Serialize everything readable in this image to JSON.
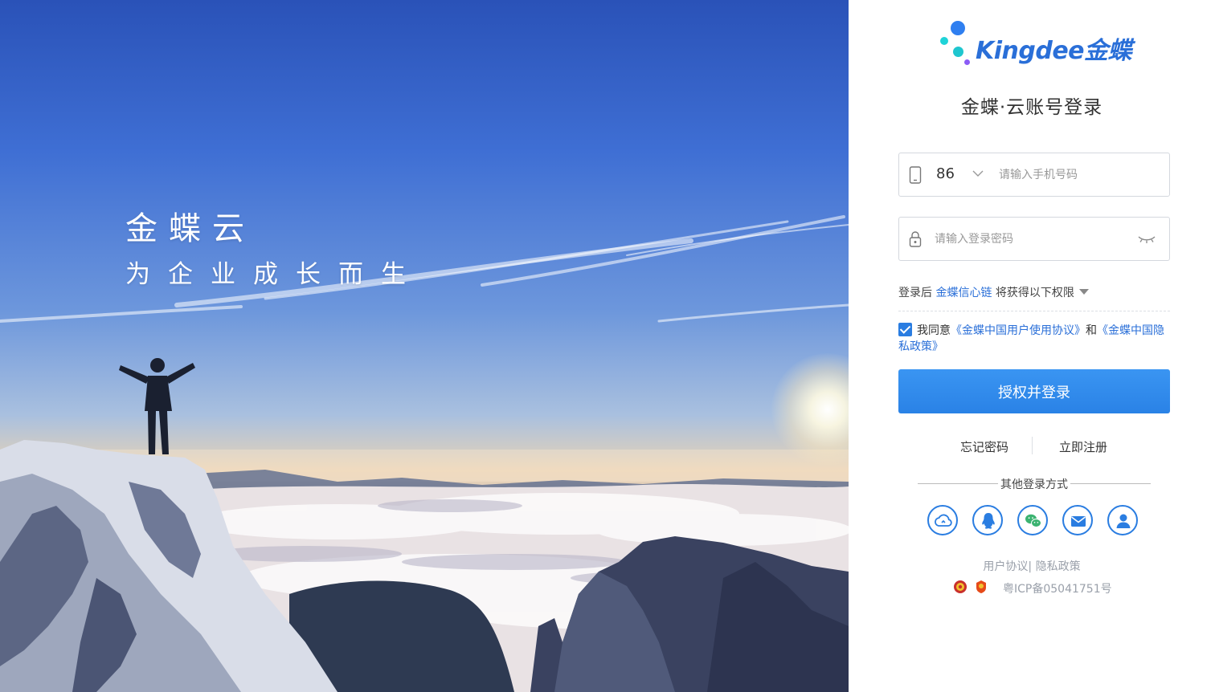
{
  "hero": {
    "title": "金蝶云",
    "subtitle": "为企业成长而生"
  },
  "brand": {
    "logo_text": "Kingdee金蝶",
    "accent": "#2a6fd8",
    "dot_colors": [
      "#2f7ff0",
      "#1fd3d8",
      "#1fc6cf",
      "#8b5cf6"
    ]
  },
  "login": {
    "title": "金蝶·云账号登录",
    "country_code": "86",
    "phone_placeholder": "请输入手机号码",
    "password_placeholder": "请输入登录密码",
    "permission_prefix": "登录后",
    "permission_link": "金蝶信心链",
    "permission_suffix": "将获得以下权限",
    "agree_prefix": "我同意",
    "agree_link1": "《金蝶中国用户使用协议》",
    "agree_and": "和",
    "agree_link2": "《金蝶中国隐私政策》",
    "agree_checked": true,
    "submit_label": "授权并登录",
    "forgot_label": "忘记密码",
    "register_label": "立即注册",
    "other_methods_label": "其他登录方式",
    "other_methods": [
      "cloud-icon",
      "qq-icon",
      "wechat-icon",
      "email-icon",
      "user-icon"
    ]
  },
  "footer": {
    "agreement_link": "用户协议|",
    "privacy_link": "隐私政策",
    "icp": "粤ICP备05041751号"
  }
}
